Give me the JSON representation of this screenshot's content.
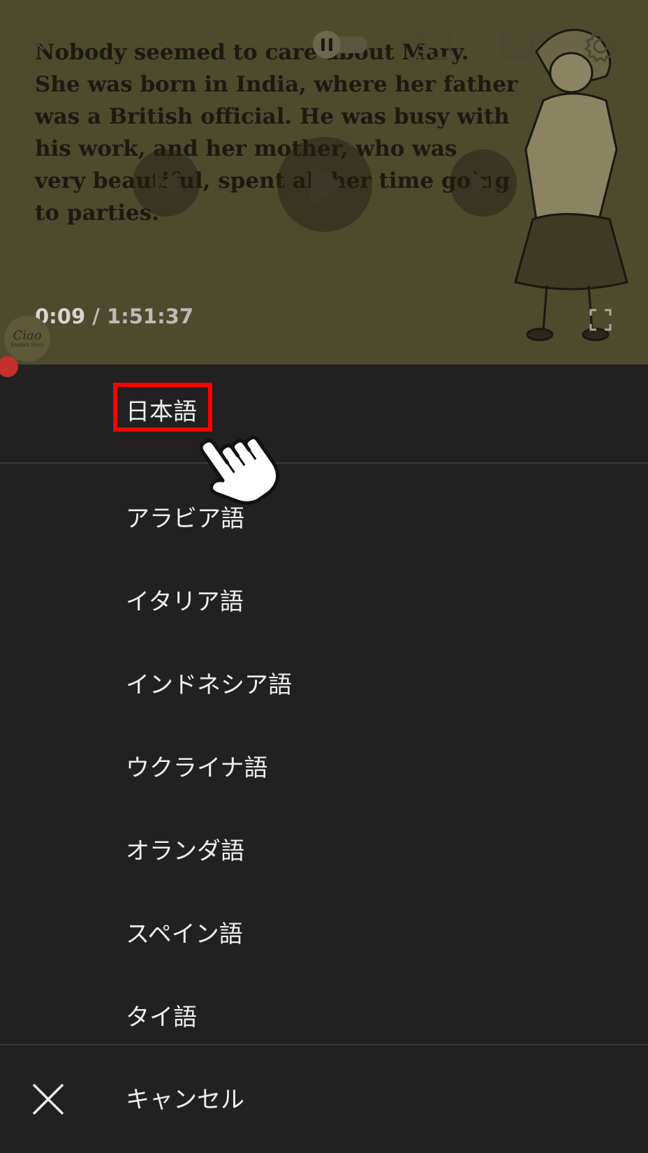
{
  "player": {
    "story_lines": "Nobody seemed to care about Mary.\nShe was born in India, where her father\nwas a British official. He was busy with\nhis work, and her mother, who was\nvery beautiful, spent all her time going\nto parties.",
    "time_current": "0:09",
    "time_separator": " / ",
    "time_total": "1:51:37",
    "channel_logo": {
      "main": "Ciao",
      "sub": "English Story"
    },
    "icons": [
      "chevron-down-icon",
      "pause-toggle-icon",
      "cast-icon",
      "captions-icon",
      "gear-icon",
      "previous-icon",
      "play-icon",
      "next-icon",
      "fullscreen-icon"
    ]
  },
  "menu": {
    "selected_label": "日本語",
    "items": [
      {
        "label": "アラビア語"
      },
      {
        "label": "イタリア語"
      },
      {
        "label": "インドネシア語"
      },
      {
        "label": "ウクライナ語"
      },
      {
        "label": "オランダ語"
      },
      {
        "label": "スペイン語"
      },
      {
        "label": "タイ語"
      }
    ],
    "cancel_label": "キャンセル"
  },
  "colors": {
    "menu_background": "#212121",
    "highlight_border": "#ff0000",
    "progress_accent": "#c4302b",
    "text": "#eeeeee"
  }
}
